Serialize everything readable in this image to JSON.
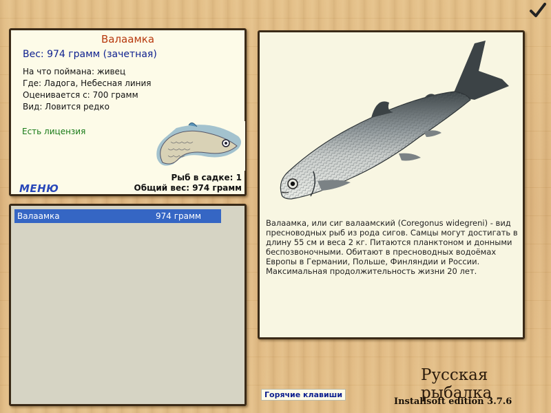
{
  "fish": {
    "name": "Валаамка",
    "weight_line": "Вес: 974 грамм (зачетная)",
    "caught_on": "На что поймана: живец",
    "location": "Где: Ладога, Небесная линия",
    "valued_from": "Оценивается с: 700 грамм",
    "kind": "Вид: Ловится редко",
    "license": "Есть лицензия"
  },
  "cage": {
    "count_label": "Рыб в садке: 1",
    "total_label": "Общий вес: 974 грамм"
  },
  "menu_label": "МЕНЮ",
  "catch_list": [
    {
      "name": "Валаамка",
      "weight": "974 грамм"
    }
  ],
  "description": "Валаамка, или сиг валаамский (Coregonus widegreni) - вид пресноводных рыб из рода сигов. Самцы могут достигать в длину 55 см и веса 2 кг. Питаются планктоном и донными беспозвоночными. Обитают в пресноводных водоёмах Европы в Германии, Польше, Финляндии и России. Максимальная продолжительность жизни 20 лет.",
  "hotkeys_label": "Горячие клавиши",
  "brand": "Русская рыбалка",
  "edition": "Installsoft edition 3.7.6",
  "colors": {
    "title": "#b7390e",
    "weight": "#0c1f8f",
    "license": "#177a17",
    "selection": "#3566c4"
  },
  "icons": [
    "checkmark-icon",
    "fish-emblem-icon",
    "fish-illustration"
  ]
}
